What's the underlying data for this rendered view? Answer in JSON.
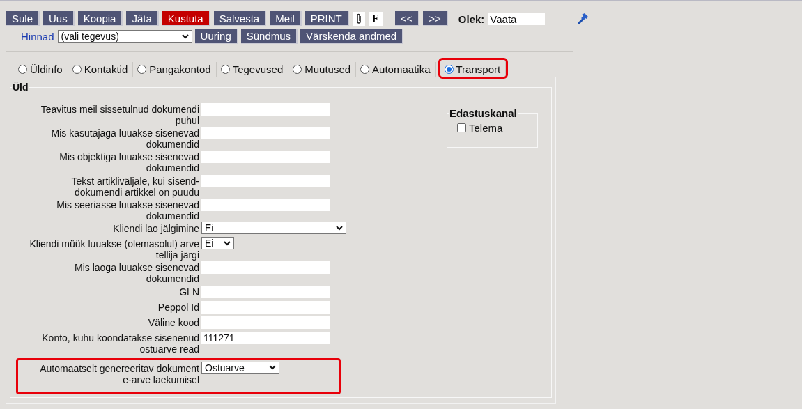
{
  "toolbar": {
    "buttons": [
      {
        "label": "Sule",
        "kind": "normal"
      },
      {
        "label": "Uus",
        "kind": "normal"
      },
      {
        "label": "Koopia",
        "kind": "normal"
      },
      {
        "label": "Jäta",
        "kind": "normal"
      },
      {
        "label": "Kustuta",
        "kind": "danger"
      },
      {
        "label": "Salvesta",
        "kind": "normal"
      },
      {
        "label": "Meil",
        "kind": "normal"
      },
      {
        "label": "PRINT",
        "kind": "normal"
      }
    ],
    "font_button": "F",
    "nav_buttons": [
      "<<",
      ">>"
    ],
    "status_label": "Olek:",
    "status_value": "Vaata"
  },
  "action_row": {
    "link": "Hinnad",
    "action_select": "(vali tegevus)",
    "buttons": [
      "Uuring",
      "Sündmus",
      "Värskenda andmed"
    ]
  },
  "tabs": [
    {
      "label": "Üldinfo",
      "selected": false,
      "highlighted": false
    },
    {
      "label": "Kontaktid",
      "selected": false,
      "highlighted": false
    },
    {
      "label": "Pangakontod",
      "selected": false,
      "highlighted": false
    },
    {
      "label": "Tegevused",
      "selected": false,
      "highlighted": false
    },
    {
      "label": "Muutused",
      "selected": false,
      "highlighted": false
    },
    {
      "label": "Automaatika",
      "selected": false,
      "highlighted": false
    },
    {
      "label": "Transport",
      "selected": true,
      "highlighted": true
    }
  ],
  "section": {
    "title": "Üld",
    "rows": [
      {
        "label": "Teavitus meil sissetulnud dokumendi puhul",
        "kind": "text",
        "highlighted": false
      },
      {
        "label": "Mis kasutajaga luuakse sisenevad dokumendid",
        "kind": "text",
        "highlighted": false
      },
      {
        "label": "Mis objektiga luuakse sisenevad dokumendid",
        "kind": "text",
        "highlighted": false
      },
      {
        "label": "Tekst artikliväljale, kui sisend-dokumendi artikkel on puudu",
        "kind": "text",
        "highlighted": false
      },
      {
        "label": "Mis seeriasse luuakse sisenevad dokumendid",
        "kind": "text",
        "highlighted": false
      },
      {
        "label": "Kliendi lao jälgimine",
        "kind": "dropdown",
        "value": "Ei",
        "highlighted": false
      },
      {
        "label": "Kliendi müük luuakse (olemasolul) arve tellija järgi",
        "kind": "yesno",
        "value": "Ei",
        "highlighted": false
      },
      {
        "label": "Mis laoga luuakse sisenevad dokumendid",
        "kind": "text",
        "highlighted": false
      },
      {
        "label": "GLN",
        "kind": "text",
        "highlighted": false
      },
      {
        "label": "Peppol Id",
        "kind": "text",
        "highlighted": false
      },
      {
        "label": "Väline kood",
        "kind": "text",
        "highlighted": false
      },
      {
        "label": "Konto, kuhu koondatakse sisenenud ostuarve read",
        "kind": "text",
        "value": "111271",
        "highlighted": false
      },
      {
        "label": "Automaatselt genereeritav dokument e-arve laekumisel",
        "kind": "select",
        "value": "Ostuarve",
        "highlighted": true
      }
    ]
  },
  "channel": {
    "title": "Edastuskanal",
    "options": [
      {
        "label": "Telema",
        "checked": false
      }
    ]
  }
}
